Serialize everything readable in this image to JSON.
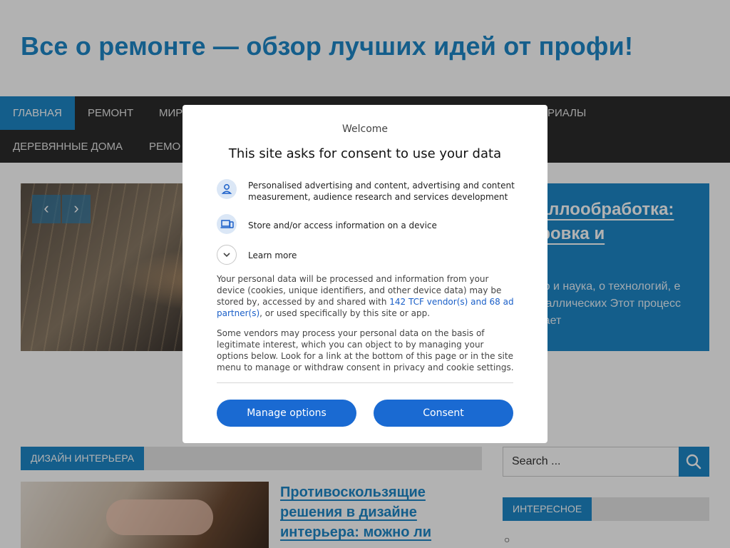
{
  "site": {
    "title": "Все о ремонте — обзор лучших идей от профи!"
  },
  "nav": {
    "row1": [
      {
        "label": "Главная",
        "active": true
      },
      {
        "label": "Ремонт"
      },
      {
        "label": "Мир"
      },
      {
        "label": "риалы"
      }
    ],
    "row2": [
      {
        "label": "Деревянные дома"
      },
      {
        "label": "Ремо"
      }
    ]
  },
  "slider": {
    "prev_icon": "chevron-left-icon",
    "next_icon": "chevron-right-icon",
    "panel_title": "таллообработка: еровка и",
    "panel_text": "ство и наука, о технологий, е металлических Этот процесс играет"
  },
  "sections": {
    "interior_tag": "Дизайн интерьера",
    "post_title": "Противоскользящие решения в дизайне интерьера: можно ли совместить эстетику и"
  },
  "sidebar": {
    "search_placeholder": "Search ...",
    "search_icon": "search-icon",
    "widget_tag": "Интересное",
    "bullet": "○"
  },
  "consent": {
    "welcome": "Welcome",
    "heading": "This site asks for consent to use your data",
    "purposes": [
      {
        "icon": "person-icon",
        "text": "Personalised advertising and content, advertising and content measurement, audience research and services development"
      },
      {
        "icon": "devices-icon",
        "text": "Store and/or access information on a device"
      },
      {
        "icon": "chevron-down-icon",
        "text": "Learn more"
      }
    ],
    "para1_before": "Your personal data will be processed and information from your device (cookies, unique identifiers, and other device data) may be stored by, accessed by and shared with ",
    "para1_link": "142 TCF vendor(s) and 68 ad partner(s)",
    "para1_after": ", or used specifically by this site or app.",
    "para2": "Some vendors may process your personal data on the basis of legitimate interest, which you can object to by managing your options below. Look for a link at the bottom of this page or in the site menu to manage or withdraw consent in privacy and cookie settings.",
    "manage_button": "Manage options",
    "consent_button": "Consent"
  },
  "colors": {
    "brand": "#1e87c8",
    "nav_bg": "#2b2b2b",
    "button": "#1a6ad2"
  }
}
